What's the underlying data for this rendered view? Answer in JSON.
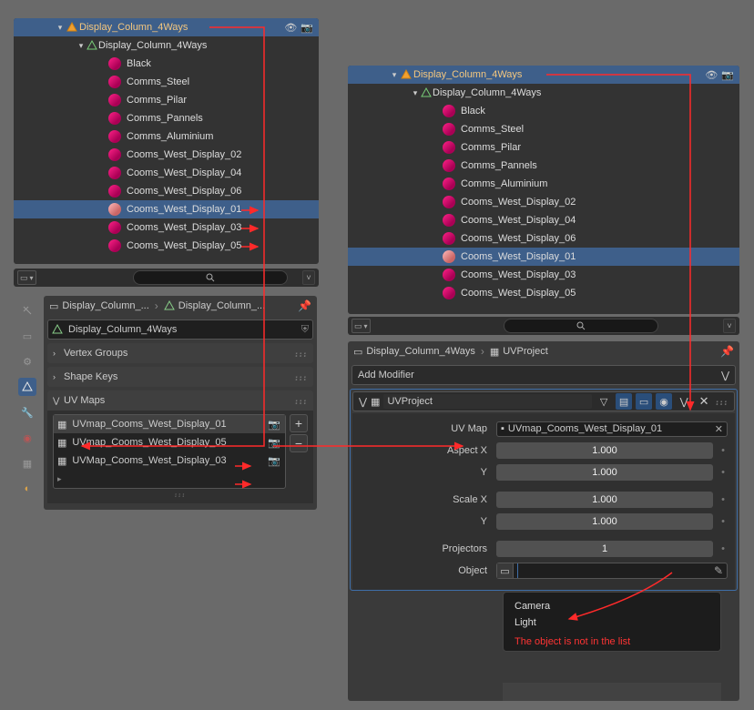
{
  "left_outliner": {
    "root": "Display_Column_4Ways",
    "child": "Display_Column_4Ways",
    "materials": [
      "Black",
      "Comms_Steel",
      "Comms_Pilar",
      "Comms_Pannels",
      "Comms_Aluminium",
      "Cooms_West_Display_02",
      "Cooms_West_Display_04",
      "Cooms_West_Display_06",
      "Cooms_West_Display_01",
      "Cooms_West_Display_03",
      "Cooms_West_Display_05"
    ],
    "selected_index": 8
  },
  "right_outliner": {
    "root": "Display_Column_4Ways",
    "child": "Display_Column_4Ways",
    "materials": [
      "Black",
      "Comms_Steel",
      "Comms_Pilar",
      "Comms_Pannels",
      "Comms_Aluminium",
      "Cooms_West_Display_02",
      "Cooms_West_Display_04",
      "Cooms_West_Display_06",
      "Cooms_West_Display_01",
      "Cooms_West_Display_03",
      "Cooms_West_Display_05"
    ],
    "selected_index": 8
  },
  "search_placeholder": "",
  "left_breadcrumb": {
    "obj": "Display_Column_...",
    "data": "Display_Column_..."
  },
  "left_name_field": "Display_Column_4Ways",
  "sections": {
    "vg": "Vertex Groups",
    "sk": "Shape Keys",
    "uv": "UV Maps"
  },
  "uv_maps": [
    "UVmap_Cooms_West_Display_01",
    "UVmap_Cooms_West_Display_05",
    "UVMap_Cooms_West_Display_03"
  ],
  "uv_active_index": 0,
  "right_breadcrumb": {
    "obj": "Display_Column_4Ways",
    "mod": "UVProject"
  },
  "add_modifier": "Add Modifier",
  "modifier": {
    "name": "UVProject",
    "uv_map_value": "UVmap_Cooms_West_Display_01",
    "labels": {
      "uvmap": "UV Map",
      "aspectx": "Aspect X",
      "aspecty": "Y",
      "scalex": "Scale X",
      "scaley": "Y",
      "projectors": "Projectors",
      "object": "Object"
    },
    "values": {
      "aspectx": "1.000",
      "aspecty": "1.000",
      "scalex": "1.000",
      "scaley": "1.000",
      "projectors": "1"
    }
  },
  "popup": {
    "opts": [
      "Camera",
      "Light"
    ],
    "err": "The object is not in the list"
  }
}
